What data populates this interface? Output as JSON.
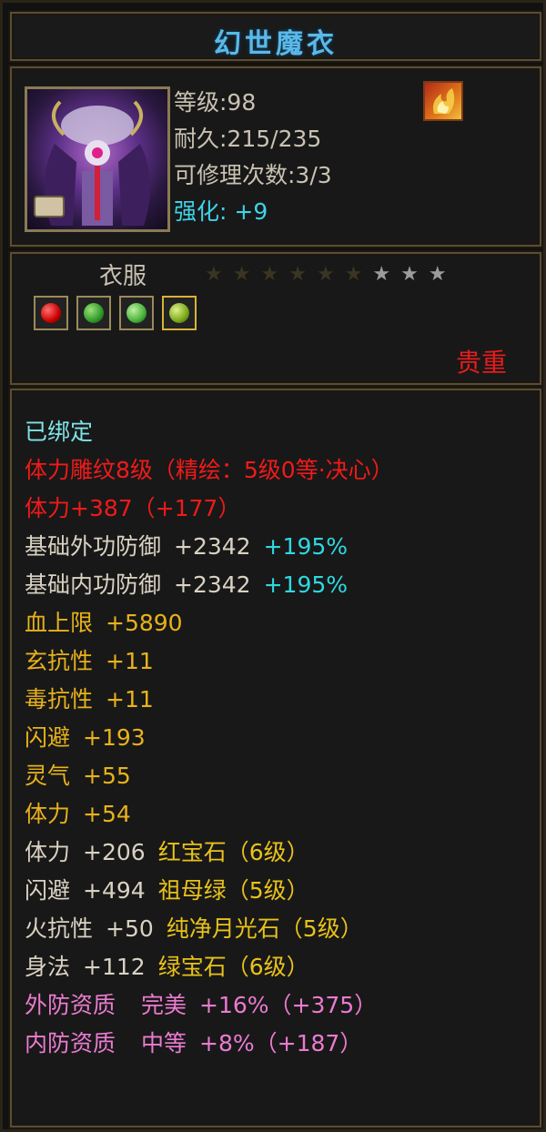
{
  "item": {
    "name": "幻世魔衣",
    "level": "等级:98",
    "durability": "耐久:215/235",
    "repairs": "可修理次数:3/3",
    "enhance_label": "强化:",
    "enhance_value": "+9",
    "slot": "衣服",
    "rarity": "贵重",
    "stars_total": 9,
    "stars_dim": 6,
    "gem_icons": [
      "ruby-icon",
      "emerald-icon",
      "green-jade-icon",
      "moonstone-icon"
    ]
  },
  "attributes": {
    "bound": "已绑定",
    "engrave": "体力雕纹8级（精绘：5级0等·决心）",
    "stamina_total": "体力+387（+177）",
    "ext_def": {
      "name": "基础外功防御",
      "value": "+2342",
      "pct": "+195%"
    },
    "int_def": {
      "name": "基础内功防御",
      "value": "+2342",
      "pct": "+195%"
    },
    "hp": {
      "name": "血上限",
      "value": "+5890"
    },
    "xuan_res": {
      "name": "玄抗性",
      "value": "+11"
    },
    "poison_res": {
      "name": "毒抗性",
      "value": "+11"
    },
    "dodge": {
      "name": "闪避",
      "value": "+193"
    },
    "aura": {
      "name": "灵气",
      "value": "+55"
    },
    "stamina": {
      "name": "体力",
      "value": "+54"
    },
    "gem1": {
      "name": "体力",
      "value": "+206",
      "gem": "红宝石（6级）"
    },
    "gem2": {
      "name": "闪避",
      "value": "+494",
      "gem": "祖母绿（5级）"
    },
    "gem3": {
      "name": "火抗性",
      "value": "+50",
      "gem": "纯净月光石（5级）"
    },
    "gem4": {
      "name": "身法",
      "value": "+112",
      "gem": "绿宝石（6级）"
    },
    "q1": {
      "name": "外防资质",
      "grade": "完美",
      "value": "+16%（+375）"
    },
    "q2": {
      "name": "内防资质",
      "grade": "中等",
      "value": "+8%（+187）"
    }
  },
  "colors": {
    "title": "#5bb8e8",
    "rarity": "#e81c1c",
    "attr_yellow": "#e8b21a",
    "quality_pink": "#ea7bd0"
  }
}
